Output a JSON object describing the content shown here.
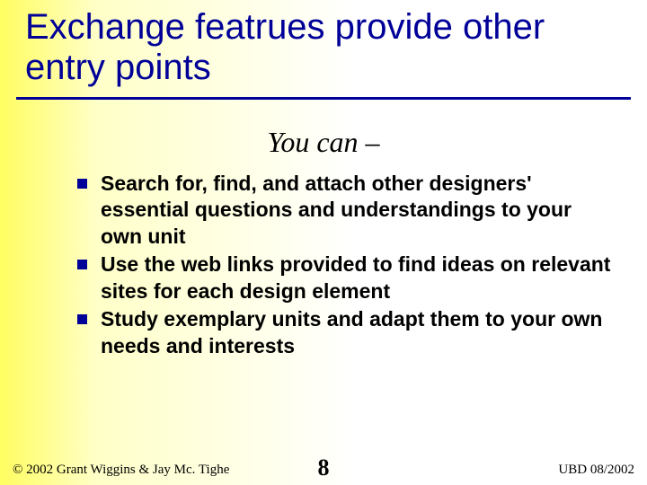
{
  "title": "Exchange featrues provide other entry points",
  "subtitle": "You can –",
  "bullets": [
    "Search for, find, and attach other designers' essential questions and understandings to your own unit",
    "Use the web links provided to find ideas on relevant sites for each design element",
    "Study exemplary units and adapt them to your own needs and interests"
  ],
  "footer": {
    "left": "© 2002 Grant Wiggins & Jay Mc. Tighe",
    "center": "8",
    "right": "UBD 08/2002"
  }
}
